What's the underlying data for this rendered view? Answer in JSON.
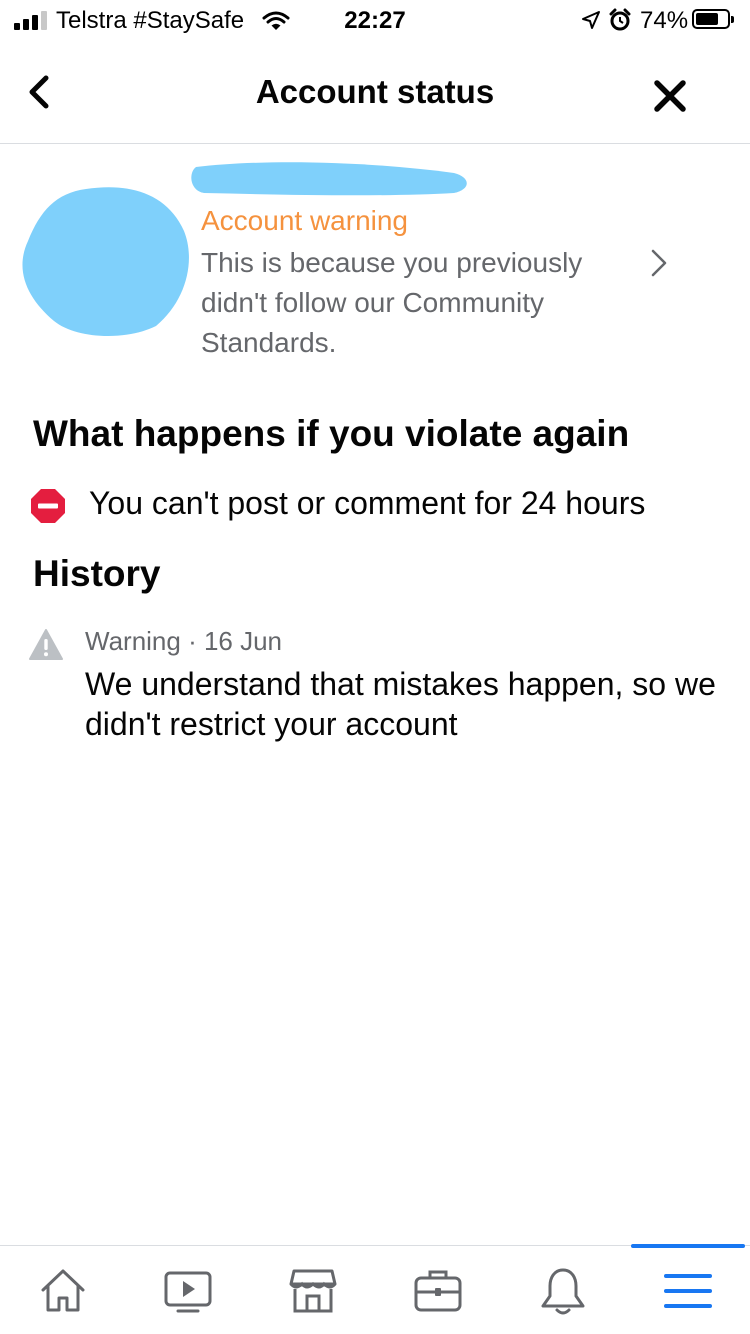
{
  "status_bar": {
    "carrier": "Telstra #StaySafe",
    "time": "22:27",
    "battery_percent": "74%",
    "battery_level": 0.74,
    "icons": [
      "signal-icon",
      "wifi-icon",
      "location-icon",
      "alarm-icon",
      "battery-icon"
    ]
  },
  "header": {
    "title": "Account status",
    "back_icon": "chevron-left-icon",
    "close_icon": "close-icon"
  },
  "account": {
    "warning_label": "Account warning",
    "warning_description": "This is because you previously didn't follow our Community Standards.",
    "chevron_icon": "chevron-right-icon"
  },
  "consequences": {
    "title": "What happens if you violate again",
    "penalty": "You can't post or comment for 24 hours",
    "penalty_icon": "stop-icon"
  },
  "history": {
    "title": "History",
    "items": [
      {
        "meta": "Warning · 16 Jun",
        "message": "We understand that mistakes happen, so we didn't restrict your account",
        "icon": "warning-triangle-icon"
      }
    ]
  },
  "tab_bar": {
    "tabs": [
      {
        "icon": "home-icon",
        "active": false
      },
      {
        "icon": "video-icon",
        "active": false
      },
      {
        "icon": "marketplace-icon",
        "active": false
      },
      {
        "icon": "briefcase-icon",
        "active": false
      },
      {
        "icon": "bell-icon",
        "active": false
      },
      {
        "icon": "menu-icon",
        "active": true
      }
    ]
  },
  "colors": {
    "accent": "#1877f2",
    "warning_orange": "#f5923e",
    "secondary_text": "#65676b",
    "stop_red": "#e41e3f",
    "redaction_blue": "#7fd0fb"
  }
}
